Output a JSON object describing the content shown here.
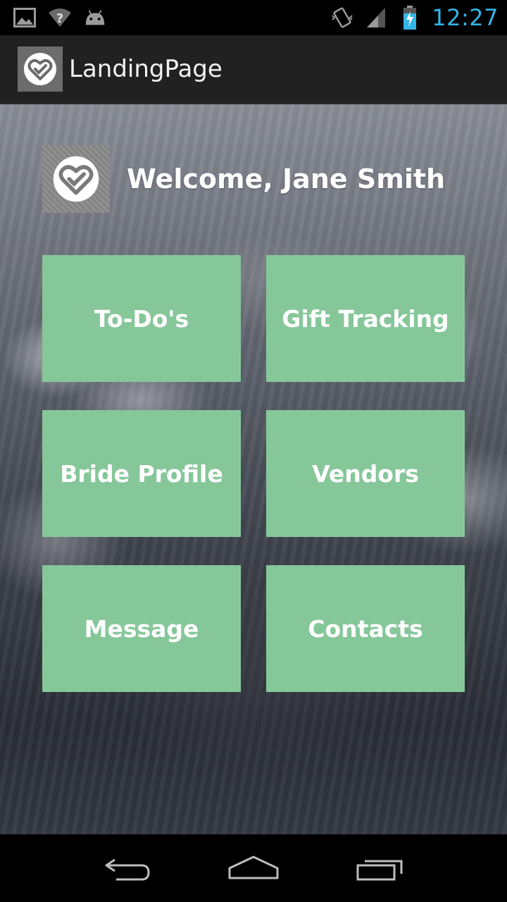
{
  "status_bar": {
    "time": "12:27",
    "icons": [
      "gallery-icon",
      "wifi-unknown-icon",
      "android-icon",
      "vibrate-icon",
      "signal-icon",
      "battery-charging-icon"
    ],
    "clock_color": "#33b5e5"
  },
  "action_bar": {
    "title": "LandingPage",
    "icon": "heart-check-icon"
  },
  "welcome": {
    "text": "Welcome, Jane Smith",
    "icon": "heart-check-icon"
  },
  "tiles": [
    {
      "label": "To-Do's"
    },
    {
      "label": "Gift Tracking"
    },
    {
      "label": "Bride Profile"
    },
    {
      "label": "Vendors"
    },
    {
      "label": "Message"
    },
    {
      "label": "Contacts"
    }
  ],
  "colors": {
    "tile": "#86c79a",
    "action_bar": "#212121"
  },
  "nav_bar": {
    "buttons": [
      "back-icon",
      "home-icon",
      "recent-apps-icon"
    ]
  }
}
